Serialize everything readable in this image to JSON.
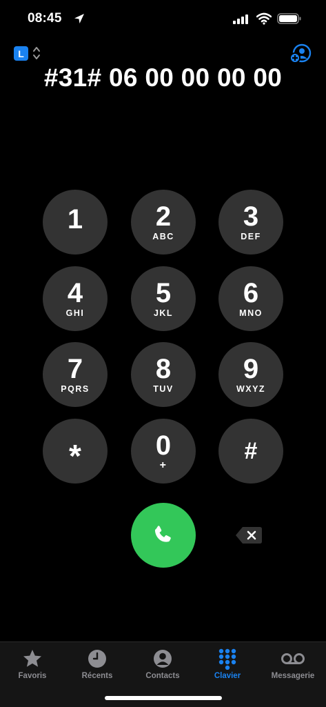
{
  "status": {
    "time": "08:45"
  },
  "line_badge": "L",
  "dialed_number": "#31# 06 00 00 00 00",
  "keypad": [
    {
      "digit": "1",
      "letters": ""
    },
    {
      "digit": "2",
      "letters": "ABC"
    },
    {
      "digit": "3",
      "letters": "DEF"
    },
    {
      "digit": "4",
      "letters": "GHI"
    },
    {
      "digit": "5",
      "letters": "JKL"
    },
    {
      "digit": "6",
      "letters": "MNO"
    },
    {
      "digit": "7",
      "letters": "PQRS"
    },
    {
      "digit": "8",
      "letters": "TUV"
    },
    {
      "digit": "9",
      "letters": "WXYZ"
    },
    {
      "digit": "*",
      "letters": ""
    },
    {
      "digit": "0",
      "letters": "+"
    },
    {
      "digit": "#",
      "letters": ""
    }
  ],
  "tabs": [
    {
      "label": "Favoris",
      "icon": "star-icon",
      "active": false
    },
    {
      "label": "Récents",
      "icon": "clock-icon",
      "active": false
    },
    {
      "label": "Contacts",
      "icon": "person-icon",
      "active": false
    },
    {
      "label": "Clavier",
      "icon": "keypad-icon",
      "active": true
    },
    {
      "label": "Messagerie",
      "icon": "voicemail-icon",
      "active": false
    }
  ],
  "colors": {
    "accent": "#1a82f0",
    "call": "#33c759",
    "key": "#333333"
  }
}
